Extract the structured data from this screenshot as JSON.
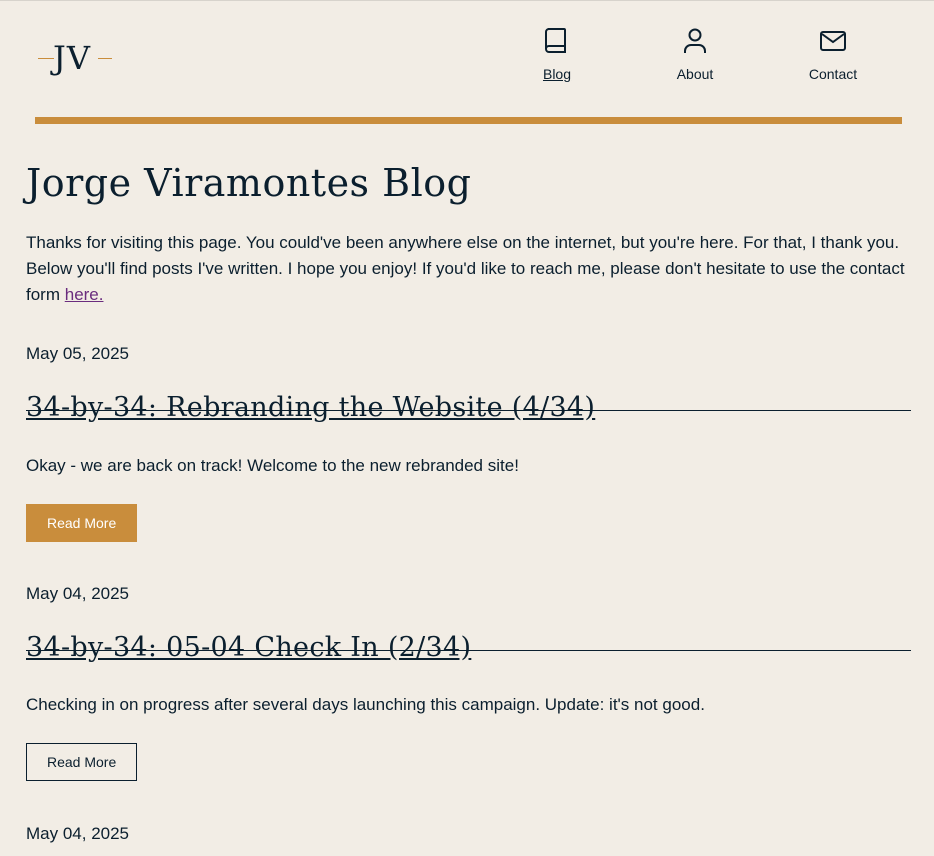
{
  "header": {
    "logo_text": "JV",
    "nav": [
      {
        "label": "Blog",
        "icon": "book-icon",
        "active": true
      },
      {
        "label": "About",
        "icon": "user-icon",
        "active": false
      },
      {
        "label": "Contact",
        "icon": "mail-icon",
        "active": false
      }
    ]
  },
  "colors": {
    "background": "#f2ede5",
    "accent": "#c98d3c",
    "text": "#0b1f2e",
    "link": "#6a2c7e"
  },
  "main": {
    "title": "Jorge Viramontes Blog",
    "intro_text": "Thanks for visiting this page. You could've been anywhere else on the internet, but you're here. For that, I thank you. Below you'll find posts I've written. I hope you enjoy! If you'd like to reach me, please don't hesitate to use the contact form ",
    "intro_link": "here.",
    "posts": [
      {
        "date": "May 05, 2025",
        "title": "34-by-34: Rebranding the Website (4/34)",
        "excerpt": "Okay - we are back on track! Welcome to the new rebranded site!",
        "button": "Read More"
      },
      {
        "date": "May 04, 2025",
        "title": "34-by-34: 05-04 Check In (2/34)",
        "excerpt": "Checking in on progress after several days launching this campaign. Update: it's not good.",
        "button": "Read More"
      },
      {
        "date": "May 04, 2025"
      }
    ]
  }
}
